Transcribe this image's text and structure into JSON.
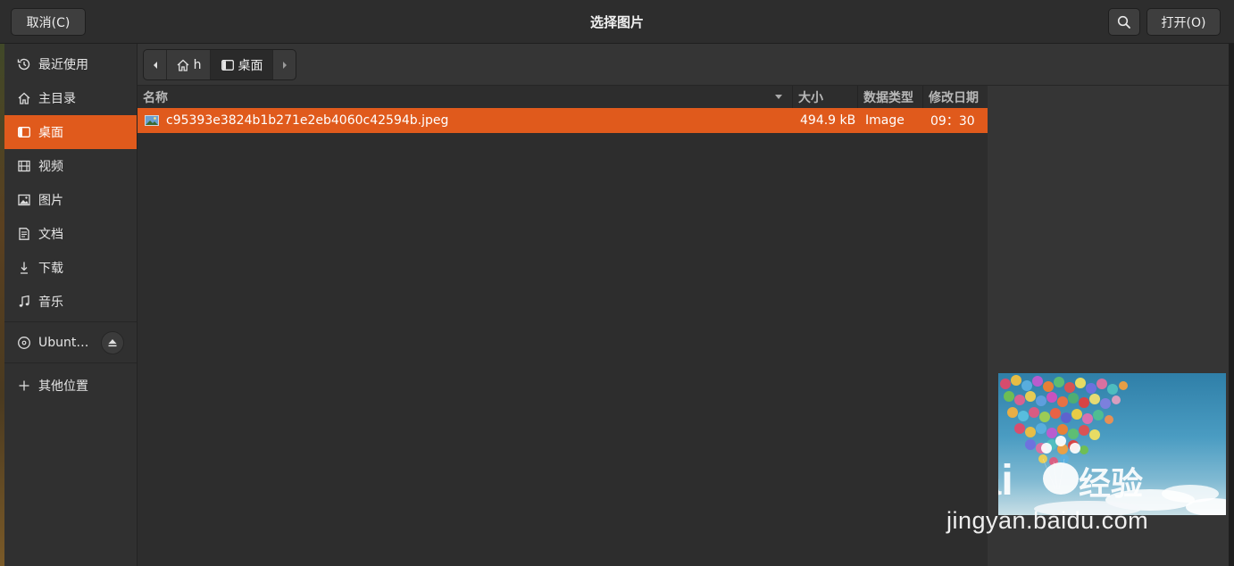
{
  "header": {
    "cancel_label": "取消(C)",
    "title": "选择图片",
    "open_label": "打开(O)"
  },
  "sidebar": {
    "items": [
      {
        "label": "最近使用",
        "icon": "clock-icon"
      },
      {
        "label": "主目录",
        "icon": "home-icon"
      },
      {
        "label": "桌面",
        "icon": "desktop-icon",
        "active": true
      },
      {
        "label": "视频",
        "icon": "film-icon"
      },
      {
        "label": "图片",
        "icon": "image-icon"
      },
      {
        "label": "文档",
        "icon": "document-icon"
      },
      {
        "label": "下载",
        "icon": "download-icon"
      },
      {
        "label": "音乐",
        "icon": "music-icon"
      }
    ],
    "device": {
      "label": "Ubunt…",
      "icon": "disc-icon"
    },
    "other": {
      "label": "其他位置",
      "icon": "plus-icon"
    }
  },
  "pathbar": {
    "home_label": "h",
    "current_label": "桌面"
  },
  "columns": {
    "name": "名称",
    "size": "大小",
    "type": "数据类型",
    "modified": "修改日期"
  },
  "files": [
    {
      "name": "c95393e3824b1b271e2eb4060c42594b.jpeg",
      "size": "494.9 kB",
      "type": "Image",
      "modified": "09：30",
      "selected": true
    }
  ],
  "watermark": {
    "logo_text": "Bai",
    "logo_text_2": "经验",
    "url": "jingyan.baidu.com"
  },
  "colors": {
    "accent": "#e05a1c",
    "background": "#353535"
  }
}
